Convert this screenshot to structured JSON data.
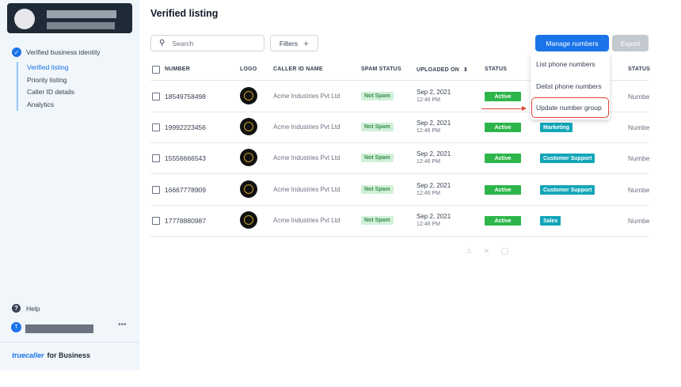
{
  "sidebar": {
    "section_title": "Verified business identity",
    "items": [
      {
        "label": "Verified listing",
        "active": true
      },
      {
        "label": "Priority listing",
        "active": false
      },
      {
        "label": "Caller ID details",
        "active": false
      },
      {
        "label": "Analytics",
        "active": false
      }
    ],
    "help_label": "Help",
    "user_initial": "T",
    "more_label": "•••",
    "brand_name": "truecaller",
    "brand_suffix": "for Business"
  },
  "header": {
    "title": "Verified listing",
    "search_placeholder": "Search",
    "filters_label": "Filters",
    "manage_label": "Manage numbers",
    "export_label": "Export"
  },
  "table": {
    "columns": [
      "NUMBER",
      "LOGO",
      "CALLER ID NAME",
      "SPAM STATUS",
      "UPLOADED ON",
      "STATUS",
      "STATUS"
    ],
    "rows": [
      {
        "number": "18549758498",
        "caller_id": "Acme Industries Pvt Ltd",
        "spam": "Not Spam",
        "date": "Sep 2, 2021",
        "time": "12:46 PM",
        "status": "Active",
        "group": "",
        "type": "Numbe"
      },
      {
        "number": "19992223456",
        "caller_id": "Acme Industries Pvt Ltd",
        "spam": "Not Spam",
        "date": "Sep 2, 2021",
        "time": "12:46 PM",
        "status": "Active",
        "group": "Marketing",
        "type": "Numbe"
      },
      {
        "number": "15556666543",
        "caller_id": "Acme Industries Pvt Ltd",
        "spam": "Not Spam",
        "date": "Sep 2, 2021",
        "time": "12:46 PM",
        "status": "Active",
        "group": "Customer Support",
        "type": "Numbe"
      },
      {
        "number": "16667778909",
        "caller_id": "Acme Industries Pvt Ltd",
        "spam": "Not Spam",
        "date": "Sep 2, 2021",
        "time": "12:46 PM",
        "status": "Active",
        "group": "Customer Support",
        "type": "Numbe"
      },
      {
        "number": "17778880987",
        "caller_id": "Acme Industries Pvt Ltd",
        "spam": "Not Spam",
        "date": "Sep 2, 2021",
        "time": "12:46 PM",
        "status": "Active",
        "group": "Sales",
        "type": "Numbe"
      }
    ]
  },
  "dropdown": {
    "items": [
      "List phone numbers",
      "Delist phone numbers",
      "Update number group"
    ],
    "highlighted": "Update number group"
  },
  "pager_icons": "⚠ ✕ ◯",
  "colors": {
    "primary": "#1a73e8",
    "active_green": "#2db54a",
    "group_teal": "#12a5b8",
    "spam_bg": "#d1f0d8",
    "highlight_red": "#e0433a",
    "sidebar_bg": "#f1f6fb"
  }
}
